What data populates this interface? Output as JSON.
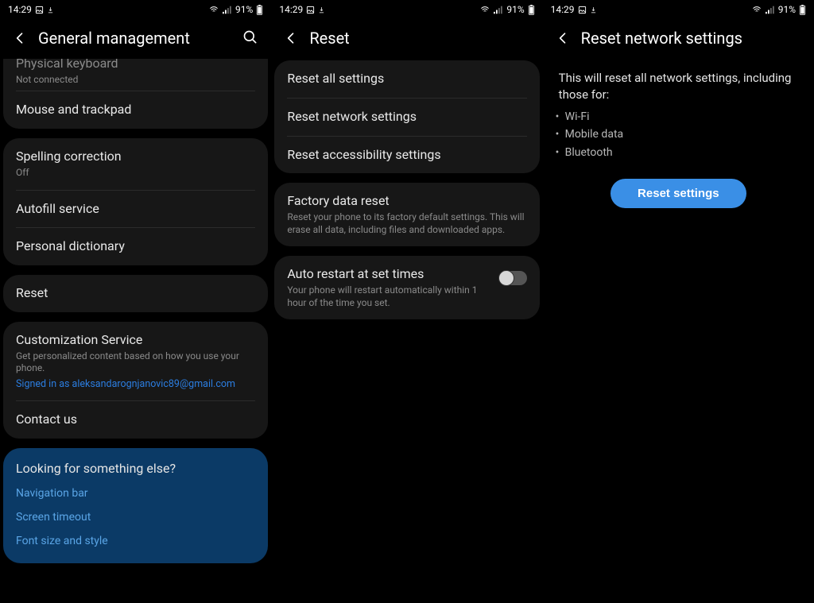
{
  "status": {
    "time": "14:29",
    "battery": "91%"
  },
  "panel1": {
    "title": "General management",
    "physical_keyboard": {
      "title": "Physical keyboard",
      "sub": "Not connected"
    },
    "mouse_trackpad": "Mouse and trackpad",
    "spelling": {
      "title": "Spelling correction",
      "sub": "Off"
    },
    "autofill": "Autofill service",
    "dictionary": "Personal dictionary",
    "reset": "Reset",
    "customization": {
      "title": "Customization Service",
      "sub": "Get personalized content based on how you use your phone.",
      "link": "Signed in as aleksandarognjanovic89@gmail.com"
    },
    "contact": "Contact us",
    "suggest": {
      "title": "Looking for something else?",
      "nav": "Navigation bar",
      "timeout": "Screen timeout",
      "font": "Font size and style"
    }
  },
  "panel2": {
    "title": "Reset",
    "reset_all": "Reset all settings",
    "reset_network": "Reset network settings",
    "reset_accessibility": "Reset accessibility settings",
    "factory": {
      "title": "Factory data reset",
      "sub": "Reset your phone to its factory default settings. This will erase all data, including files and downloaded apps."
    },
    "auto_restart": {
      "title": "Auto restart at set times",
      "sub": "Your phone will restart automatically within 1 hour of the time you set."
    }
  },
  "panel3": {
    "title": "Reset network settings",
    "info": "This will reset all network settings, including those for:",
    "bullets": {
      "wifi": "Wi-Fi",
      "mobile": "Mobile data",
      "bt": "Bluetooth"
    },
    "button": "Reset settings"
  }
}
